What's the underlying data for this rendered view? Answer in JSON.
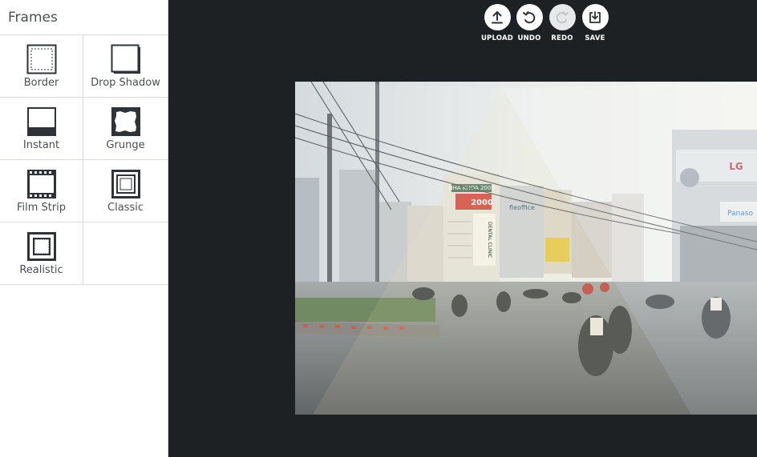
{
  "sidebar": {
    "title": "Frames",
    "frames": [
      {
        "label": "Border",
        "icon": "border-frame-icon"
      },
      {
        "label": "Drop Shadow",
        "icon": "drop-shadow-frame-icon"
      },
      {
        "label": "Instant",
        "icon": "instant-frame-icon"
      },
      {
        "label": "Grunge",
        "icon": "grunge-frame-icon"
      },
      {
        "label": "Film Strip",
        "icon": "film-strip-frame-icon"
      },
      {
        "label": "Classic",
        "icon": "classic-frame-icon"
      },
      {
        "label": "Realistic",
        "icon": "realistic-frame-icon"
      }
    ]
  },
  "toolbar": {
    "upload": "UPLOAD",
    "undo": "UNDO",
    "redo": "REDO",
    "save": "SAVE",
    "redo_enabled": false
  },
  "canvas": {
    "photo_text": {
      "sign_top": "NHA KHOA 2000",
      "sign_2000": "2000",
      "sign_office": "fleoffice",
      "sign_lg": "LG",
      "sign_panasonic": "Panaso",
      "sign_vertical": "DENTAL CLINIC"
    }
  },
  "colors": {
    "panel_bg": "#ffffff",
    "workspace_bg": "#1e2124",
    "icon_dark": "#2e3338",
    "text": "#4a4f55",
    "divider": "#d7d9dc"
  }
}
